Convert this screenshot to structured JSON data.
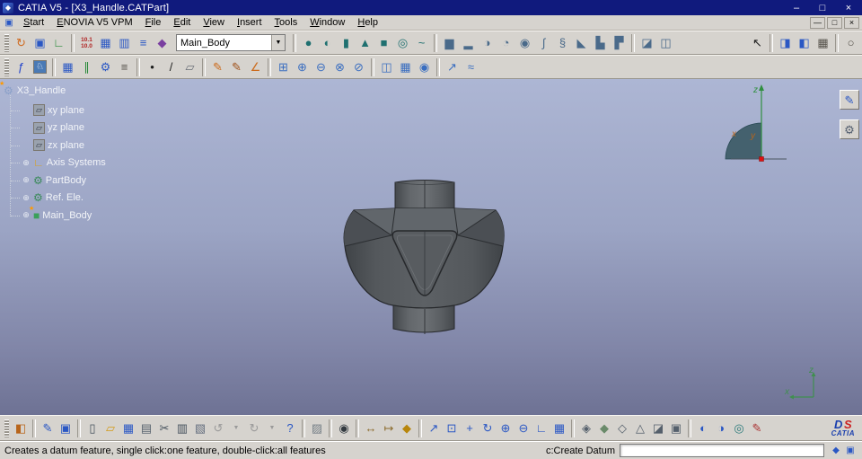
{
  "colors": {
    "titlebar": "#101a7d",
    "chrome": "#d6d3ce",
    "viewport_top": "#adb6d4",
    "viewport_bottom": "#6e7294",
    "tree_text": "#f2f4f8",
    "accent": "#2a57c4"
  },
  "window": {
    "title": "CATIA V5 - [X3_Handle.CATPart]",
    "app_glyph": "◆",
    "controls": {
      "min": "–",
      "max": "□",
      "close": "×"
    }
  },
  "menu": {
    "doc_glyph": "▣",
    "items": [
      {
        "name": "menu-start",
        "u": "S",
        "rest": "tart"
      },
      {
        "name": "menu-enovia",
        "u": "E",
        "rest": "NOVIA V5 VPM"
      },
      {
        "name": "menu-file",
        "u": "F",
        "rest": "ile"
      },
      {
        "name": "menu-edit",
        "u": "E",
        "rest": "dit"
      },
      {
        "name": "menu-view",
        "u": "V",
        "rest": "iew"
      },
      {
        "name": "menu-insert",
        "u": "I",
        "rest": "nsert"
      },
      {
        "name": "menu-tools",
        "u": "T",
        "rest": "ools"
      },
      {
        "name": "menu-window",
        "u": "W",
        "rest": "indow"
      },
      {
        "name": "menu-help",
        "u": "H",
        "rest": "elp"
      }
    ],
    "mdi": {
      "min": "—",
      "restore": "□",
      "close": "×"
    }
  },
  "toolbars": {
    "combo": {
      "value": "Main_Body",
      "arrow": "▼"
    },
    "row1a": [
      {
        "k": "handle"
      },
      {
        "name": "enovia-sync-icon",
        "g": "↻",
        "c": "#cf6a1f"
      },
      {
        "name": "window-manager-icon",
        "g": "▣",
        "c": "#2a57c4"
      },
      {
        "name": "axis-system-icon",
        "g": "∟",
        "c": "#2a8a3a"
      },
      {
        "k": "sep"
      },
      {
        "name": "release-level-icon",
        "g": "10.1\n10.0",
        "c": "#b02020",
        "s": "txt"
      },
      {
        "name": "design-table-icon",
        "g": "▦",
        "c": "#2a57c4"
      },
      {
        "name": "catalog-icon",
        "g": "▥",
        "c": "#2a57c4"
      },
      {
        "name": "object-list-icon",
        "g": "≡",
        "c": "#2a57c4"
      },
      {
        "name": "macros-icon",
        "g": "◆",
        "c": "#7a3fa0"
      }
    ],
    "row1b": [
      {
        "k": "sep"
      },
      {
        "name": "sphere-icon",
        "g": "●",
        "c": "#1f7070"
      },
      {
        "name": "hemisphere-icon",
        "g": "◐",
        "c": "#1f7070"
      },
      {
        "name": "cylinder-icon",
        "g": "▮",
        "c": "#1f7070"
      },
      {
        "name": "cone-icon",
        "g": "▲",
        "c": "#1f7070"
      },
      {
        "name": "cube-icon",
        "g": "■",
        "c": "#1f7070"
      },
      {
        "name": "torus-icon",
        "g": "◎",
        "c": "#1f7070"
      },
      {
        "name": "sweep-icon",
        "g": "~",
        "c": "#1f7070"
      },
      {
        "k": "sep"
      },
      {
        "name": "pad-icon",
        "g": "▆",
        "c": "#4a6a8a"
      },
      {
        "name": "pocket-icon",
        "g": "▂",
        "c": "#4a6a8a"
      },
      {
        "name": "shaft-icon",
        "g": "◑",
        "c": "#4a6a8a"
      },
      {
        "name": "groove-icon",
        "g": "◔",
        "c": "#4a6a8a"
      },
      {
        "name": "hole-icon",
        "g": "◉",
        "c": "#4a6a8a"
      },
      {
        "name": "rib-icon",
        "g": "∫",
        "c": "#4a6a8a"
      },
      {
        "name": "slot-icon",
        "g": "§",
        "c": "#4a6a8a"
      },
      {
        "name": "stiffener-icon",
        "g": "◣",
        "c": "#4a6a8a"
      },
      {
        "name": "multi-pad-icon",
        "g": "▙",
        "c": "#4a6a8a"
      },
      {
        "name": "drafted-pad-icon",
        "g": "▛",
        "c": "#4a6a8a"
      },
      {
        "k": "sep"
      },
      {
        "name": "sew-surface-icon",
        "g": "◪",
        "c": "#4a6a8a"
      },
      {
        "name": "close-surface-icon",
        "g": "◫",
        "c": "#4a6a8a"
      },
      {
        "k": "spacer"
      },
      {
        "name": "select-icon",
        "g": "↖",
        "c": "#1c1c1c"
      },
      {
        "k": "sep"
      },
      {
        "name": "selection-sets-icon",
        "g": "◨",
        "c": "#2a57c4"
      },
      {
        "name": "selection-filter-icon",
        "g": "◧",
        "c": "#2a57c4"
      },
      {
        "name": "grid-icon",
        "g": "▦",
        "c": "#55514a"
      },
      {
        "k": "sep"
      },
      {
        "name": "quick-select-icon",
        "g": "○",
        "c": "#55514a"
      }
    ],
    "row2": [
      {
        "k": "handle"
      },
      {
        "name": "formula-icon",
        "g": "ƒ",
        "c": "#2244cc"
      },
      {
        "name": "knowledge-advisor-icon",
        "g": "♘",
        "c": "#ffffff",
        "bg": "#4a7ab5"
      },
      {
        "k": "sep"
      },
      {
        "name": "design-table2-icon",
        "g": "▦",
        "c": "#2a57c4"
      },
      {
        "name": "constraints-icon",
        "g": "∥",
        "c": "#2a8a3a"
      },
      {
        "name": "relations-icon",
        "g": "⚙",
        "c": "#2a57c4"
      },
      {
        "name": "equivalent-dimensions-icon",
        "g": "≡",
        "c": "#55514a"
      },
      {
        "k": "sep"
      },
      {
        "name": "point-icon",
        "g": "•",
        "c": "#1c1c1c"
      },
      {
        "name": "line-icon",
        "g": "/",
        "c": "#1c1c1c"
      },
      {
        "name": "plane-icon",
        "g": "▱",
        "c": "#6a6f78"
      },
      {
        "k": "sep"
      },
      {
        "name": "sketch-icon",
        "g": "✎",
        "c": "#cc6a1a"
      },
      {
        "name": "positioned-sketch-icon",
        "g": "✎",
        "c": "#a0521a"
      },
      {
        "name": "sketch-axis-icon",
        "g": "∠",
        "c": "#cc6a1a"
      },
      {
        "k": "sep"
      },
      {
        "name": "assemble-icon",
        "g": "⊞",
        "c": "#3a6ec0"
      },
      {
        "name": "add-body-icon",
        "g": "⊕",
        "c": "#3a6ec0"
      },
      {
        "name": "remove-body-icon",
        "g": "⊖",
        "c": "#3a6ec0"
      },
      {
        "name": "intersect-body-icon",
        "g": "⊗",
        "c": "#3a6ec0"
      },
      {
        "name": "union-trim-icon",
        "g": "⊘",
        "c": "#3a6ec0"
      },
      {
        "k": "sep"
      },
      {
        "name": "mirror-icon",
        "g": "◫",
        "c": "#3a6ec0"
      },
      {
        "name": "rect-pattern-icon",
        "g": "▦",
        "c": "#3a6ec0"
      },
      {
        "name": "circ-pattern-icon",
        "g": "◉",
        "c": "#3a6ec0"
      },
      {
        "k": "sep"
      },
      {
        "name": "scaling-icon",
        "g": "↗",
        "c": "#3a6ec0"
      },
      {
        "name": "thickness-icon",
        "g": "≈",
        "c": "#3a6ec0"
      }
    ],
    "bottom": [
      {
        "k": "handle"
      },
      {
        "name": "graphic-properties-icon",
        "g": "◧",
        "c": "#b8651b"
      },
      {
        "k": "sep"
      },
      {
        "name": "sketcher-icon",
        "g": "✎",
        "c": "#2a57c4"
      },
      {
        "name": "workbench-icon",
        "g": "▣",
        "c": "#2a57c4"
      },
      {
        "k": "sep"
      },
      {
        "name": "new-file-icon",
        "g": "▯",
        "c": "#44505c"
      },
      {
        "name": "open-file-icon",
        "g": "▱",
        "c": "#d49a17"
      },
      {
        "name": "save-icon",
        "g": "▦",
        "c": "#2a57c4"
      },
      {
        "name": "print-icon",
        "g": "▤",
        "c": "#55606c"
      },
      {
        "name": "cut-icon",
        "g": "✂",
        "c": "#44505c"
      },
      {
        "name": "copy-icon",
        "g": "▥",
        "c": "#44505c"
      },
      {
        "name": "paste-icon",
        "g": "▧",
        "c": "#667080"
      },
      {
        "name": "undo-icon",
        "g": "↺",
        "c": "#9a9a9a"
      },
      {
        "name": "undo-history-icon",
        "g": "▼",
        "c": "#9a9a9a",
        "s": "small"
      },
      {
        "name": "redo-icon",
        "g": "↻",
        "c": "#9a9a9a"
      },
      {
        "name": "redo-history-icon",
        "g": "▼",
        "c": "#9a9a9a",
        "s": "small"
      },
      {
        "name": "help-icon",
        "g": "?",
        "c": "#2a57c4"
      },
      {
        "k": "sep"
      },
      {
        "name": "clipboard-icon",
        "g": "▨",
        "c": "#778088"
      },
      {
        "k": "sep"
      },
      {
        "name": "capture-icon",
        "g": "◉",
        "c": "#333a40"
      },
      {
        "k": "sep"
      },
      {
        "name": "measure-between-icon",
        "g": "↔",
        "c": "#8a6a2a"
      },
      {
        "name": "measure-item-icon",
        "g": "↦",
        "c": "#8a6a2a"
      },
      {
        "name": "measure-inertia-icon",
        "g": "◆",
        "c": "#b8860b"
      },
      {
        "k": "sep"
      },
      {
        "name": "fly-mode-icon",
        "g": "↗",
        "c": "#2a57c4"
      },
      {
        "name": "fit-all-icon",
        "g": "⊡",
        "c": "#2a57c4"
      },
      {
        "name": "pan-icon",
        "g": "+",
        "c": "#2a57c4"
      },
      {
        "name": "rotate-icon",
        "g": "↻",
        "c": "#2a57c4"
      },
      {
        "name": "zoom-in-icon",
        "g": "⊕",
        "c": "#2a57c4"
      },
      {
        "name": "zoom-out-icon",
        "g": "⊖",
        "c": "#2a57c4"
      },
      {
        "name": "normal-view-icon",
        "g": "∟",
        "c": "#2a57c4"
      },
      {
        "name": "multi-view-icon",
        "g": "▦",
        "c": "#2a57c4"
      },
      {
        "k": "sep"
      },
      {
        "name": "iso-view-icon",
        "g": "◈",
        "c": "#55606c"
      },
      {
        "name": "shading-icon",
        "g": "◆",
        "c": "#6a8a6a"
      },
      {
        "name": "shading-edges-icon",
        "g": "◇",
        "c": "#55606c"
      },
      {
        "name": "wireframe-icon",
        "g": "△",
        "c": "#55606c"
      },
      {
        "name": "hidden-line-icon",
        "g": "◪",
        "c": "#55606c"
      },
      {
        "name": "customize-view-icon",
        "g": "▣",
        "c": "#55606c"
      },
      {
        "k": "sep"
      },
      {
        "name": "hide-show-icon",
        "g": "◐",
        "c": "#2a57c4"
      },
      {
        "name": "swap-space-icon",
        "g": "◑",
        "c": "#2a57c4"
      },
      {
        "name": "magnifier-icon",
        "g": "◎",
        "c": "#2a7a7a"
      },
      {
        "name": "sketch-analysis-icon",
        "g": "✎",
        "c": "#aa3333"
      }
    ]
  },
  "tree": {
    "root": {
      "label": "X3_Handle",
      "g": "⚙",
      "badge": "★"
    },
    "items": [
      {
        "name": "tree-item-xy-plane",
        "label": "xy plane",
        "g": "▱",
        "c": "#2f3542",
        "bg": "#9aa2ae",
        "exp": ""
      },
      {
        "name": "tree-item-yz-plane",
        "label": "yz plane",
        "g": "▱",
        "c": "#2f3542",
        "bg": "#9aa2ae",
        "exp": ""
      },
      {
        "name": "tree-item-zx-plane",
        "label": "zx plane",
        "g": "▱",
        "c": "#2f3542",
        "bg": "#9aa2ae",
        "exp": ""
      },
      {
        "name": "tree-item-axis-systems",
        "label": "Axis Systems",
        "g": "∟",
        "c": "#d8a020",
        "exp": "⊕"
      },
      {
        "name": "tree-item-partbody",
        "label": "PartBody",
        "g": "⚙",
        "c": "#3a8a5a",
        "exp": "⊕"
      },
      {
        "name": "tree-item-ref-ele",
        "label": "Ref. Ele.",
        "g": "⚙",
        "c": "#3a8a5a",
        "exp": "⊕"
      },
      {
        "name": "tree-item-main-body",
        "label": "Main_Body",
        "g": "■",
        "c": "#3aa05a",
        "exp": "⊕",
        "badge": "★"
      }
    ]
  },
  "viewport": {
    "side_tools": [
      {
        "name": "current-workbench-icon",
        "g": "✎",
        "c": "#2a57c4"
      },
      {
        "name": "compass-tool-icon",
        "g": "⚙",
        "c": "#556070"
      }
    ],
    "compass": {
      "z": "z",
      "x": "x",
      "y": "y"
    },
    "triad": {
      "z": "z",
      "x": "x"
    }
  },
  "status": {
    "message": "Creates a datum feature, single click:one feature, double-click:all features",
    "command_label": "c:Create Datum",
    "command_value": "",
    "icons": [
      {
        "name": "tip-icon",
        "g": "◆",
        "c": "#2a57c4"
      },
      {
        "name": "commands-list-icon",
        "g": "▣",
        "c": "#2a57c4"
      }
    ]
  },
  "logo": {
    "mark_blue": "D",
    "mark_red": "S",
    "text": "CATIA"
  }
}
